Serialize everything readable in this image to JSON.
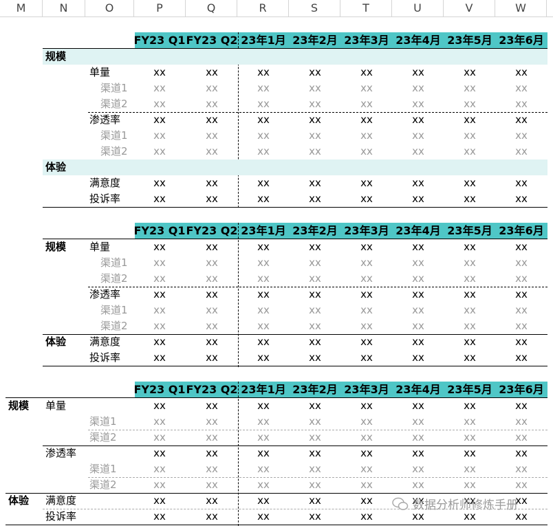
{
  "columns": [
    "M",
    "N",
    "O",
    "P",
    "Q",
    "R",
    "S",
    "T",
    "U",
    "V",
    "W"
  ],
  "period_headers": [
    "FY23 Q1",
    "FY23 Q2",
    "23年1月",
    "23年2月",
    "23年3月",
    "23年4月",
    "23年5月",
    "23年6月"
  ],
  "placeholder": "xx",
  "labels": {
    "scale": "规模",
    "units": "单量",
    "channel1": "渠道1",
    "channel2": "渠道2",
    "penetration": "渗透率",
    "experience": "体验",
    "satisfaction": "满意度",
    "complaint": "投诉率"
  },
  "watermark": "数据分析师修炼手册",
  "colors": {
    "header_fill": "#4fc6c6",
    "section_fill": "#dff3f3",
    "sub_text": "#999999"
  }
}
